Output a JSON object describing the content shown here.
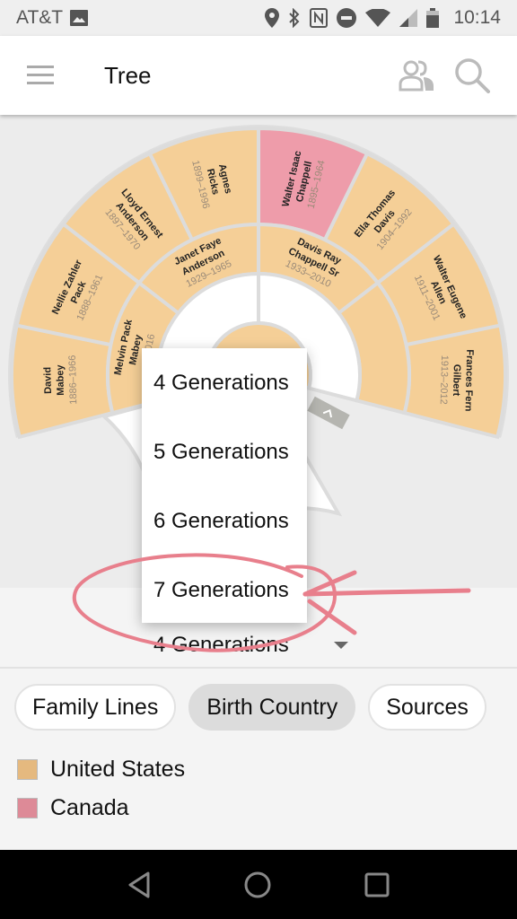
{
  "status_bar": {
    "carrier": "AT&T",
    "time": "10:14",
    "icons": [
      "image-icon",
      "location-icon",
      "bluetooth-icon",
      "nfc-icon",
      "do-not-disturb-icon",
      "wifi-icon",
      "signal-icon",
      "battery-icon"
    ]
  },
  "app_bar": {
    "title": "Tree",
    "menu_icon": "hamburger-menu-icon",
    "actions": [
      "people-icon",
      "search-icon"
    ]
  },
  "colors": {
    "united_states": "#f5cf97",
    "canada": "#ee9caa",
    "ring_border": "#dcdcdc",
    "annotation": "#e87f8c"
  },
  "fan_chart": {
    "generation4": [
      {
        "name_lines": [
          "David",
          "Mabey"
        ],
        "years": "1886–1966",
        "country": "united_states"
      },
      {
        "name_lines": [
          "Nellie Zahler",
          "Pack"
        ],
        "years": "1888–1961",
        "country": "united_states"
      },
      {
        "name_lines": [
          "Lloyd Ernest",
          "Anderson"
        ],
        "years": "1897–1970",
        "country": "united_states"
      },
      {
        "name_lines": [
          "Agnes",
          "Ricks"
        ],
        "years": "1899–1996",
        "country": "united_states"
      },
      {
        "name_lines": [
          "Walter Isaac",
          "Chappell"
        ],
        "years": "1895–1964",
        "country": "canada"
      },
      {
        "name_lines": [
          "Ella Thomas",
          "Davis"
        ],
        "years": "1904–1992",
        "country": "united_states"
      },
      {
        "name_lines": [
          "Walter Eugene",
          "Allen"
        ],
        "years": "1911–2001",
        "country": "united_states"
      },
      {
        "name_lines": [
          "Frances Fern",
          "Gilbert"
        ],
        "years": "1913–2012",
        "country": "united_states"
      }
    ],
    "generation3": [
      {
        "name_lines": [
          "Melvin Pack",
          "Mabey"
        ],
        "years": "…–2016",
        "country": "united_states"
      },
      {
        "name_lines": [
          "Janet Faye",
          "Anderson"
        ],
        "years": "1929–1965",
        "country": "united_states"
      },
      {
        "name_lines": [
          "Davis Ray",
          "Chappell Sr"
        ],
        "years": "1933–2010",
        "country": "united_states"
      },
      {
        "name_lines": [],
        "years": "",
        "country": "united_states"
      }
    ]
  },
  "generation_selector": {
    "current": "4 Generations",
    "options": [
      "4 Generations",
      "5 Generations",
      "6 Generations",
      "7 Generations"
    ],
    "highlighted_option": "7 Generations"
  },
  "view_chips": [
    {
      "label": "Family Lines",
      "active": false
    },
    {
      "label": "Birth Country",
      "active": true
    },
    {
      "label": "Sources",
      "active": false
    }
  ],
  "legend": [
    {
      "label": "United States",
      "color": "#e5b97f"
    },
    {
      "label": "Canada",
      "color": "#dd8a97"
    }
  ],
  "nav_bar": [
    "back-icon",
    "home-icon",
    "recents-icon"
  ]
}
